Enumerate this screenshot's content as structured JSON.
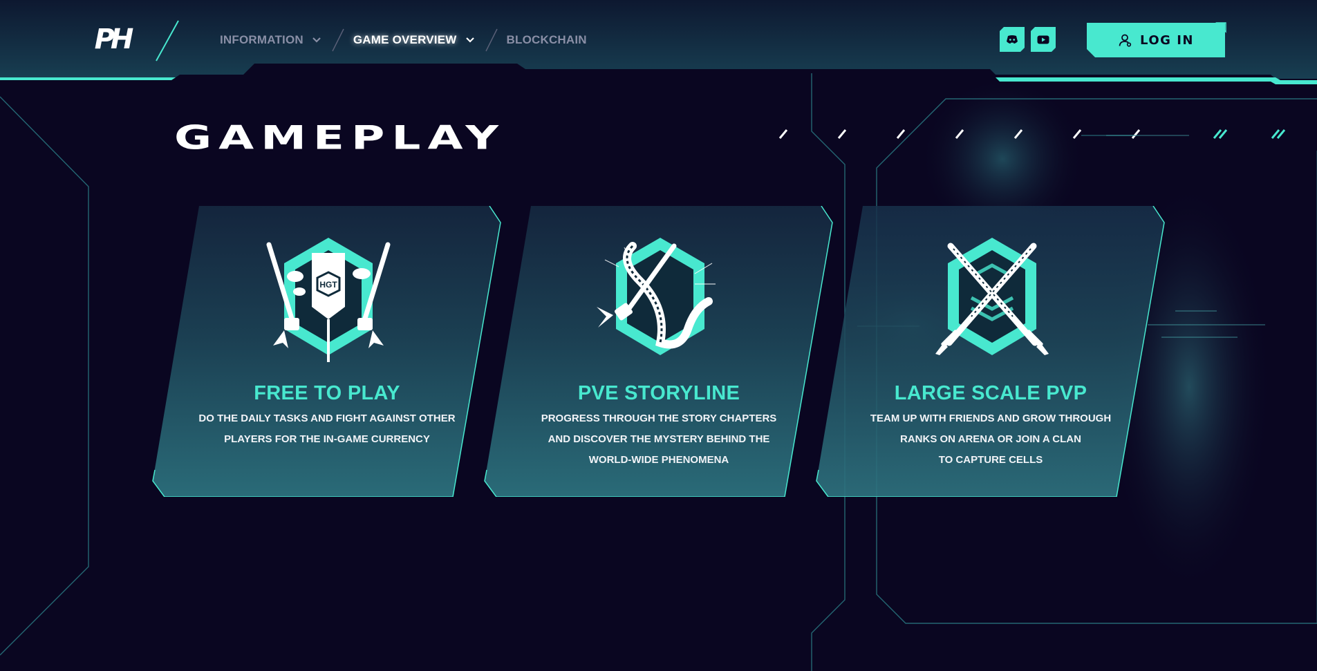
{
  "brand": {
    "logo_text": "PH"
  },
  "nav": {
    "items": [
      {
        "label": "INFORMATION",
        "has_dropdown": true,
        "active": false
      },
      {
        "label": "GAME OVERVIEW",
        "has_dropdown": true,
        "active": true
      },
      {
        "label": "BLOCKCHAIN",
        "has_dropdown": false,
        "active": false
      }
    ]
  },
  "header": {
    "social": [
      {
        "icon": "discord-icon"
      },
      {
        "icon": "youtube-icon"
      }
    ],
    "login_label": "LOG IN"
  },
  "main": {
    "title": "GAMEPLAY",
    "cards": [
      {
        "icon": "hgt-banner-swords-icon",
        "icon_text": "HGT",
        "title": "FREE TO PLAY",
        "desc_lines": [
          "DO THE DAILY TASKS AND FIGHT AGAINST OTHER",
          "PLAYERS FOR THE IN-GAME CURRENCY"
        ]
      },
      {
        "icon": "sword-tentacle-icon",
        "title": "PVE STORYLINE",
        "desc_lines": [
          "PROGRESS THROUGH THE STORY CHAPTERS",
          "AND DISCOVER THE MYSTERY BEHIND THE",
          "WORLD-WIDE PHENOMENA"
        ]
      },
      {
        "icon": "crossed-swords-icon",
        "title": "LARGE SCALE PVP",
        "desc_lines": [
          "TEAM UP WITH FRIENDS AND GROW THROUGH",
          "RANKS ON ARENA OR JOIN A CLAN",
          "TO CAPTURE CELLS"
        ]
      }
    ]
  },
  "colors": {
    "accent": "#48e8cf",
    "background": "#0a0621",
    "card": "#1f4a5a",
    "nav_inactive": "#8a8fa6"
  }
}
